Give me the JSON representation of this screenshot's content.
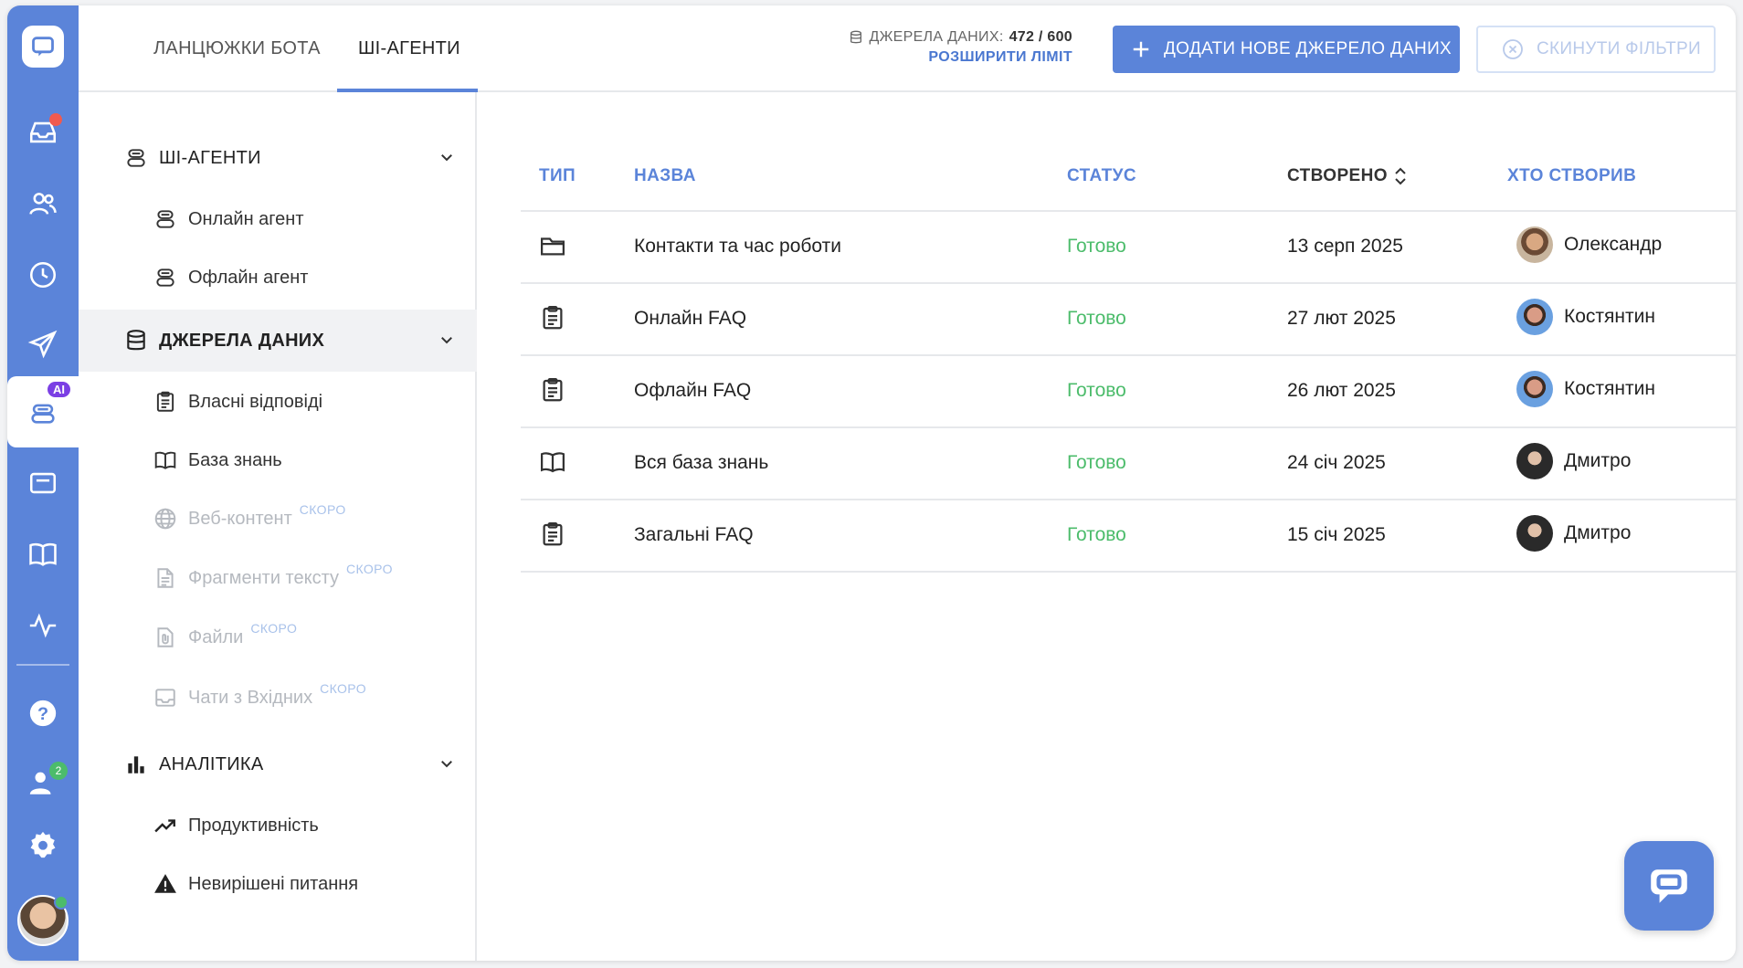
{
  "tabs": [
    {
      "label": "ЛАНЦЮЖКИ БОТА"
    },
    {
      "label": "ШІ-АГЕНТИ"
    }
  ],
  "quota": {
    "label": "ДЖЕРЕЛА ДАНИХ:",
    "value": "472 / 600",
    "link": "РОЗШИРИТИ ЛІМІТ"
  },
  "actions": {
    "add_label": "ДОДАТИ НОВЕ ДЖЕРЕЛО ДАНИХ",
    "reset_label": "СКИНУТИ ФІЛЬТРИ"
  },
  "sidebar": {
    "agents_title": "ШІ-АГЕНТИ",
    "agents": [
      {
        "label": "Онлайн агент"
      },
      {
        "label": "Офлайн агент"
      }
    ],
    "sources_title": "ДЖЕРЕЛА ДАНИХ",
    "sources": [
      {
        "label": "Власні відповіді",
        "soon": ""
      },
      {
        "label": "База знань",
        "soon": ""
      },
      {
        "label": "Веб-контент",
        "soon": "СКОРО"
      },
      {
        "label": "Фрагменти тексту",
        "soon": "СКОРО"
      },
      {
        "label": "Файли",
        "soon": "СКОРО"
      },
      {
        "label": "Чати з Вхідних",
        "soon": "СКОРО"
      }
    ],
    "analytics_title": "АНАЛІТИКА",
    "analytics": [
      {
        "label": "Продуктивність"
      },
      {
        "label": "Невирішені питання"
      }
    ]
  },
  "rail": {
    "ai_badge": "AI",
    "team_badge": "2"
  },
  "table": {
    "headers": {
      "type": "ТИП",
      "name": "НАЗВА",
      "status": "СТАТУС",
      "created": "СТВОРЕНО",
      "author": "ХТО СТВОРИВ"
    },
    "rows": [
      {
        "type_icon": "folder-icon",
        "name": "Контакти та час роботи",
        "status": "Готово",
        "created": "13 серп 2025",
        "author": "Олександр"
      },
      {
        "type_icon": "clipboard-icon",
        "name": "Онлайн FAQ",
        "status": "Готово",
        "created": "27 лют 2025",
        "author": "Костянтин"
      },
      {
        "type_icon": "clipboard-icon",
        "name": "Офлайн FAQ",
        "status": "Готово",
        "created": "26 лют 2025",
        "author": "Костянтин"
      },
      {
        "type_icon": "book-icon",
        "name": "Вся база знань",
        "status": "Готово",
        "created": "24 січ 2025",
        "author": "Дмитро"
      },
      {
        "type_icon": "clipboard-icon",
        "name": "Загальні FAQ",
        "status": "Готово",
        "created": "15 січ 2025",
        "author": "Дмитро"
      }
    ]
  },
  "colors": {
    "accent": "#5b84d9",
    "status_ready": "#4cbc6b",
    "badge_ai": "#7b3fe4",
    "notify_red": "#f05a4f"
  }
}
